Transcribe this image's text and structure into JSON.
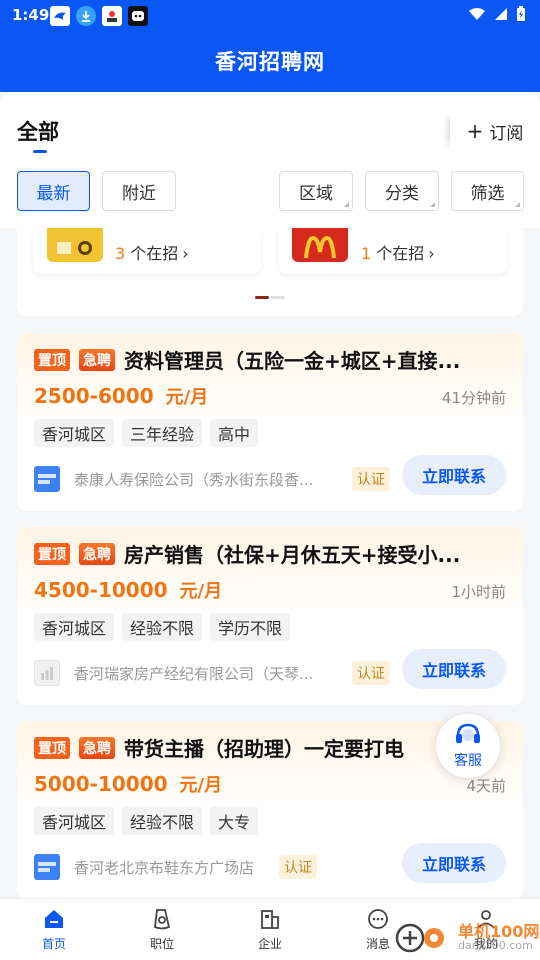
{
  "status": {
    "time": "1:49"
  },
  "header": {
    "title": "香河招聘网"
  },
  "tabs": {
    "all": "全部",
    "subscribe": "订阅"
  },
  "filters": {
    "latest": "最新",
    "nearby": "附近",
    "region": "区域",
    "category": "分类",
    "filter": "筛选"
  },
  "companies": [
    {
      "count": "3",
      "suffix": "个在招"
    },
    {
      "count": "1",
      "suffix": "个在招"
    }
  ],
  "jobs": [
    {
      "badge_top": "置顶",
      "badge_urgent": "急聘",
      "title": "资料管理员（五险一金+城区+直接...",
      "salary": "2500-6000",
      "unit": "元/月",
      "posted": "41分钟前",
      "tags": [
        "香河城区",
        "三年经验",
        "高中"
      ],
      "company": "泰康人寿保险公司（秀水街东段香...",
      "verified": "认证",
      "contact": "立即联系"
    },
    {
      "badge_top": "置顶",
      "badge_urgent": "急聘",
      "title": "房产销售（社保+月休五天+接受小...",
      "salary": "4500-10000",
      "unit": "元/月",
      "posted": "1小时前",
      "tags": [
        "香河城区",
        "经验不限",
        "学历不限"
      ],
      "company": "香河瑞家房产经纪有限公司（天琴...",
      "verified": "认证",
      "contact": "立即联系"
    },
    {
      "badge_top": "置顶",
      "badge_urgent": "急聘",
      "title": "带货主播（招助理）一定要打电",
      "salary": "5000-10000",
      "unit": "元/月",
      "posted": "4天前",
      "tags": [
        "香河城区",
        "经验不限",
        "大专"
      ],
      "company": "香河老北京布鞋东方广场店",
      "verified": "认证",
      "contact": "立即联系"
    }
  ],
  "service": {
    "label": "客服"
  },
  "nav": {
    "home": "首页",
    "jobs": "职位",
    "company": "企业",
    "messages": "消息",
    "mine": "我的"
  },
  "watermark": {
    "text": "单机100网",
    "sub": "danji100.com"
  },
  "colors": {
    "primary": "#0b57f5",
    "salary": "#f07412",
    "badge": "#f4621b"
  }
}
